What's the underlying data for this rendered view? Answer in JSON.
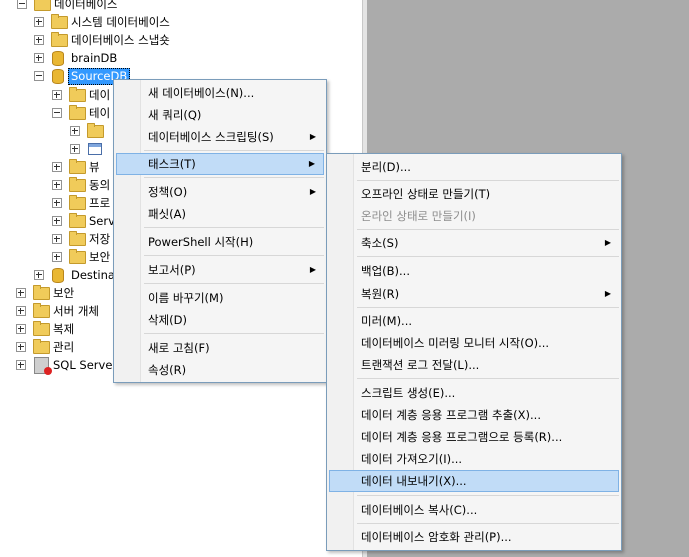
{
  "tree": {
    "databases": "데이터베이스",
    "system_databases": "시스템 데이터베이스",
    "database_snapshots": "데이터베이스 스냅숏",
    "braindb": "brainDB",
    "sourcedb": "SourceDB",
    "sourcedb_children": [
      "데이",
      "테이",
      "",
      "",
      "뷰",
      "동의",
      "프로",
      "Serv",
      "저장",
      "보안"
    ],
    "destination": "Destinat",
    "security": "보안",
    "server_objects": "서버 개체",
    "replication": "복제",
    "management": "관리",
    "sql_server_agent": "SQL Server"
  },
  "context_menu": {
    "items": [
      "새 데이터베이스(N)...",
      "새 쿼리(Q)",
      "데이터베이스 스크립팅(S)",
      "태스크(T)",
      "정책(O)",
      "패싯(A)",
      "PowerShell 시작(H)",
      "보고서(P)",
      "이름 바꾸기(M)",
      "삭제(D)",
      "새로 고침(F)",
      "속성(R)"
    ]
  },
  "tasks_submenu": {
    "items": [
      "분리(D)...",
      "오프라인 상태로 만들기(T)",
      "온라인 상태로 만들기(I)",
      "축소(S)",
      "백업(B)...",
      "복원(R)",
      "미러(M)...",
      "데이터베이스 미러링 모니터 시작(O)...",
      "트랜잭션 로그 전달(L)...",
      "스크립트 생성(E)...",
      "데이터 계층 응용 프로그램 추출(X)...",
      "데이터 계층 응용 프로그램으로 등록(R)...",
      "데이터 가져오기(I)...",
      "데이터 내보내기(X)...",
      "데이터베이스 복사(C)...",
      "데이터베이스 암호화 관리(P)..."
    ]
  },
  "arrow_glyph": "▶"
}
